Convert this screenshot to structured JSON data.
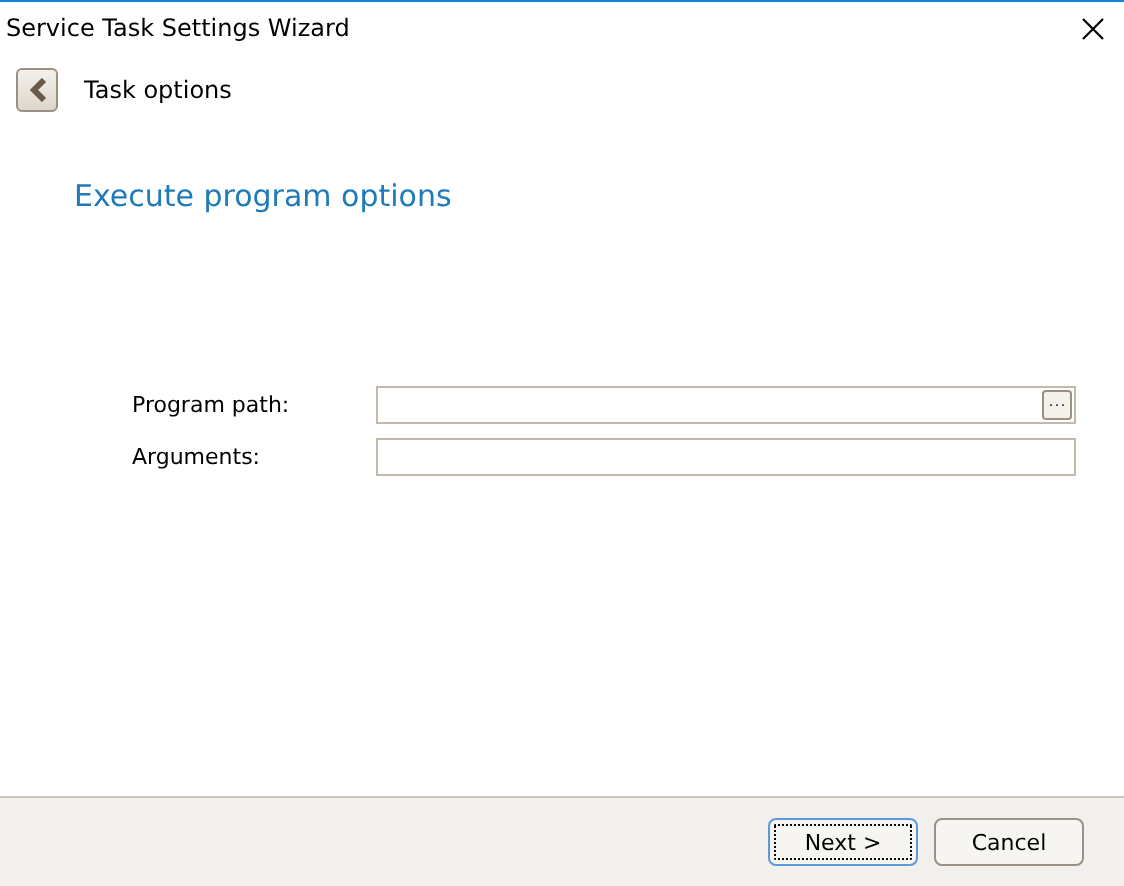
{
  "window": {
    "title": "Service Task Settings Wizard"
  },
  "header": {
    "title": "Task options"
  },
  "heading": "Execute program options",
  "fields": [
    {
      "label": "Program path:",
      "browse": "···"
    },
    {
      "label": "Arguments:"
    }
  ],
  "buttons": [
    {
      "label": "Next >",
      "focused": true
    },
    {
      "label": "Cancel",
      "focused": false
    }
  ]
}
